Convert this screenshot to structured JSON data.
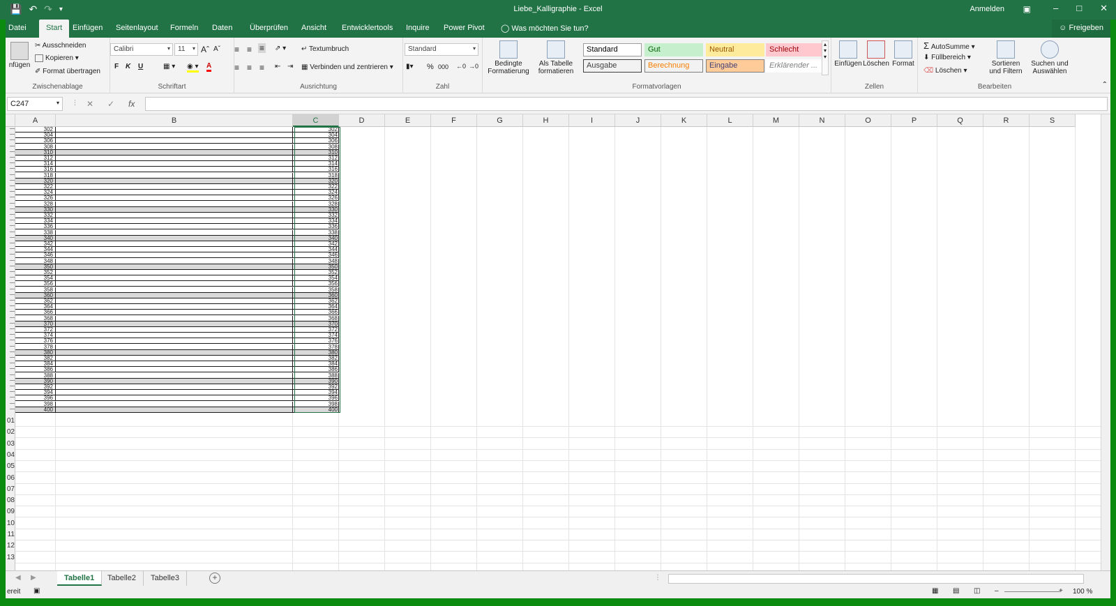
{
  "window": {
    "title": "Liebe_Kalligraphie  -  Excel",
    "signin": "Anmelden"
  },
  "tabs": [
    "Datei",
    "Start",
    "Einfügen",
    "Seitenlayout",
    "Formeln",
    "Daten",
    "Überprüfen",
    "Ansicht",
    "Entwicklertools",
    "Inquire",
    "Power Pivot"
  ],
  "tell_me": "Was möchten Sie tun?",
  "share": "Freigeben",
  "ribbon": {
    "clipboard": {
      "paste": "nfügen",
      "cut": "Ausschneiden",
      "copy": "Kopieren",
      "format_painter": "Format übertragen",
      "label": "Zwischenablage"
    },
    "font": {
      "name": "Calibri",
      "size": "11",
      "bold": "F",
      "italic": "K",
      "underline": "U",
      "label": "Schriftart"
    },
    "alignment": {
      "wrap": "Textumbruch",
      "merge": "Verbinden und zentrieren",
      "label": "Ausrichtung"
    },
    "number": {
      "format": "Standard",
      "percent": "%",
      "thousands": "000",
      "label": "Zahl"
    },
    "styles": {
      "conditional": "Bedingte Formatierung",
      "as_table": "Als Tabelle formatieren",
      "cells": [
        {
          "label": "Standard",
          "bg": "#ffffff",
          "fg": "#000000",
          "border": "#9b9b9b"
        },
        {
          "label": "Gut",
          "bg": "#c6efce",
          "fg": "#006100",
          "border": "#c6efce"
        },
        {
          "label": "Neutral",
          "bg": "#ffeb9c",
          "fg": "#9c5700",
          "border": "#ffeb9c"
        },
        {
          "label": "Schlecht",
          "bg": "#ffc7ce",
          "fg": "#9c0006",
          "border": "#ffc7ce"
        },
        {
          "label": "Ausgabe",
          "bg": "#f2f2f2",
          "fg": "#3f3f3f",
          "border": "#3f3f3f"
        },
        {
          "label": "Berechnung",
          "bg": "#f2f2f2",
          "fg": "#fa7d00",
          "border": "#7f7f7f"
        },
        {
          "label": "Eingabe",
          "bg": "#ffcc99",
          "fg": "#3f3f76",
          "border": "#7f7f7f"
        },
        {
          "label": "Erklärender ...",
          "bg": "#ffffff",
          "fg": "#7f7f7f",
          "border": "#ffffff"
        }
      ],
      "label": "Formatvorlagen"
    },
    "cells_group": {
      "insert": "Einfügen",
      "delete": "Löschen",
      "format": "Format",
      "label": "Zellen"
    },
    "editing": {
      "autosum": "AutoSumme",
      "fill": "Füllbereich",
      "clear": "Löschen",
      "sort": "Sortieren und Filtern",
      "find": "Suchen und Auswählen",
      "label": "Bearbeiten"
    }
  },
  "formula_bar": {
    "name_box": "C247",
    "fx": "fx",
    "cancel": "✕",
    "enter": "✓"
  },
  "columns": [
    "A",
    "B",
    "C",
    "D",
    "E",
    "F",
    "G",
    "H",
    "I",
    "J",
    "K",
    "L",
    "M",
    "N",
    "O",
    "P",
    "Q",
    "R",
    "S"
  ],
  "selected_column": "C",
  "row_numbers_partial": [
    "01",
    "02",
    "03",
    "04",
    "05",
    "06",
    "07",
    "08",
    "09",
    "10",
    "11",
    "12",
    "13"
  ],
  "data_values": [
    302,
    304,
    306,
    308,
    310,
    312,
    314,
    316,
    318,
    320,
    322,
    324,
    326,
    328,
    330,
    332,
    334,
    336,
    338,
    340,
    342,
    344,
    346,
    348,
    350,
    352,
    354,
    356,
    358,
    360,
    362,
    364,
    366,
    368,
    370,
    372,
    374,
    376,
    378,
    380,
    382,
    384,
    386,
    388,
    390,
    392,
    394,
    396,
    398,
    400
  ],
  "sheets": [
    "Tabelle1",
    "Tabelle2",
    "Tabelle3"
  ],
  "active_sheet": "Tabelle1",
  "status": {
    "ready": "ereit",
    "zoom": "100 %"
  }
}
